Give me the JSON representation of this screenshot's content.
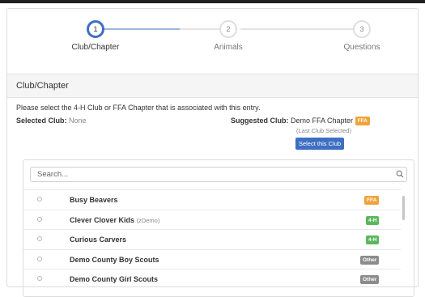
{
  "stepper": {
    "steps": [
      {
        "number": "1",
        "label": "Club/Chapter"
      },
      {
        "number": "2",
        "label": "Animals"
      },
      {
        "number": "3",
        "label": "Questions"
      }
    ]
  },
  "panel": {
    "title": "Club/Chapter",
    "instruction": "Please select the 4-H Club or FFA Chapter that is associated with this entry."
  },
  "selected": {
    "label": "Selected Club:",
    "value": "None"
  },
  "suggested": {
    "label": "Suggested Club:",
    "value": "Demo FFA Chapter",
    "badge": "FFA",
    "note": "(Last Club Selected)",
    "button": "Select this Club"
  },
  "search": {
    "placeholder": "Search..."
  },
  "clubs": [
    {
      "name": "Busy Beavers",
      "sub": "",
      "badge": "FFA"
    },
    {
      "name": "Clever Clover Kids",
      "sub": "(zDemo)",
      "badge": "4-H"
    },
    {
      "name": "Curious Carvers",
      "sub": "",
      "badge": "4-H"
    },
    {
      "name": "Demo County Boy Scouts",
      "sub": "",
      "badge": "Other"
    },
    {
      "name": "Demo County Girl Scouts",
      "sub": "",
      "badge": "Other"
    }
  ],
  "colors": {
    "accent": "#3e6fc2",
    "ffa": "#f0a23a",
    "four_h": "#5cb75c",
    "other": "#8c8c8c"
  }
}
